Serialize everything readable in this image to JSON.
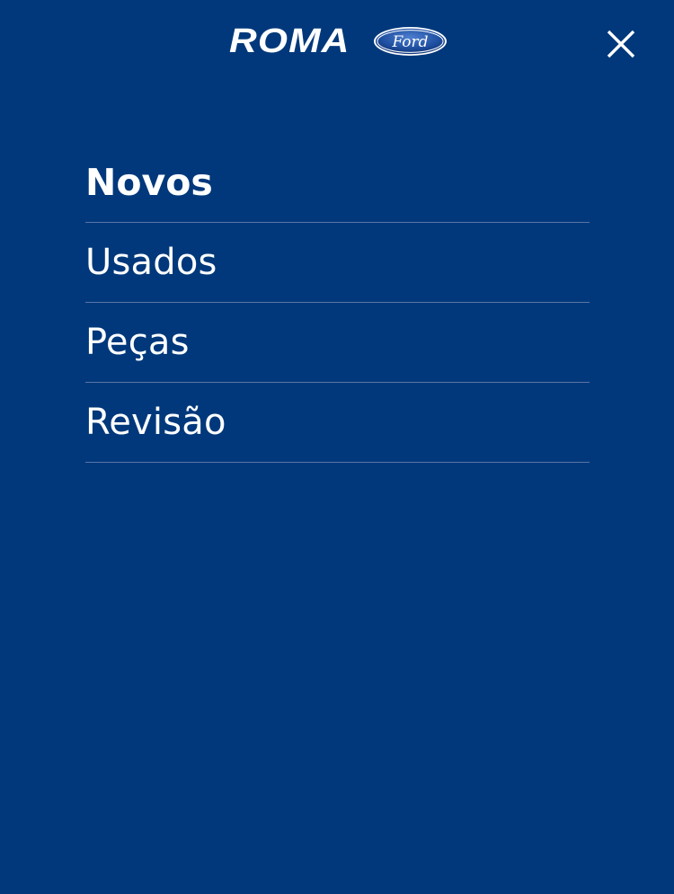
{
  "header": {
    "logo_text": "ROMA",
    "brand_text": "Ford",
    "close_icon": "close-icon"
  },
  "menu": {
    "items": [
      {
        "label": "Novos",
        "active": true
      },
      {
        "label": "Usados",
        "active": false
      },
      {
        "label": "Peças",
        "active": false
      },
      {
        "label": "Revisão",
        "active": false
      }
    ]
  },
  "colors": {
    "background": "#00387b",
    "divider": "#5876a8",
    "text": "#ffffff",
    "ford_oval": "#1e4f9e"
  }
}
